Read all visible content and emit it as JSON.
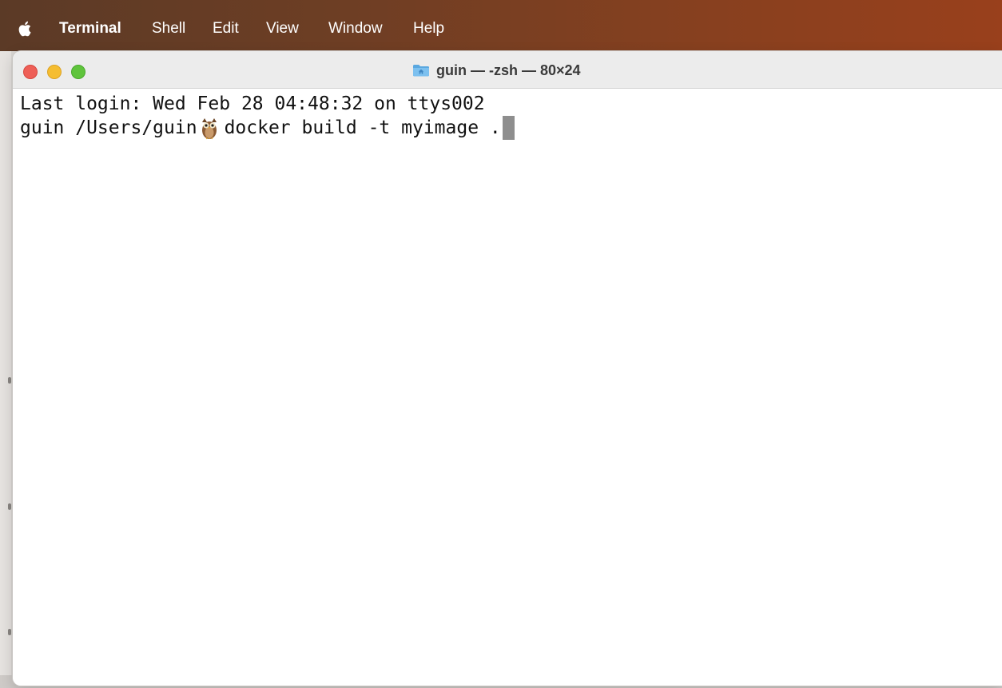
{
  "menubar": {
    "apple_icon": "apple-logo-icon",
    "items": [
      "Terminal",
      "Shell",
      "Edit",
      "View",
      "Window",
      "Help"
    ]
  },
  "window": {
    "title": "guin — -zsh — 80×24",
    "title_icon": "home-folder-icon",
    "traffic_lights": {
      "close": "#ee5f57",
      "minimize": "#f5bd30",
      "zoom": "#5fc43c"
    }
  },
  "terminal": {
    "last_login_line": "Last login: Wed Feb 28 04:48:32 on ttys002",
    "prompt_path": "guin /Users/guin",
    "prompt_icon": "owl-emoji-icon",
    "command": "docker build -t myimage ."
  },
  "colors": {
    "menubar_gradient_start": "#5b3a26",
    "menubar_gradient_end": "#99401c",
    "cursor": "#8e8e8e"
  }
}
